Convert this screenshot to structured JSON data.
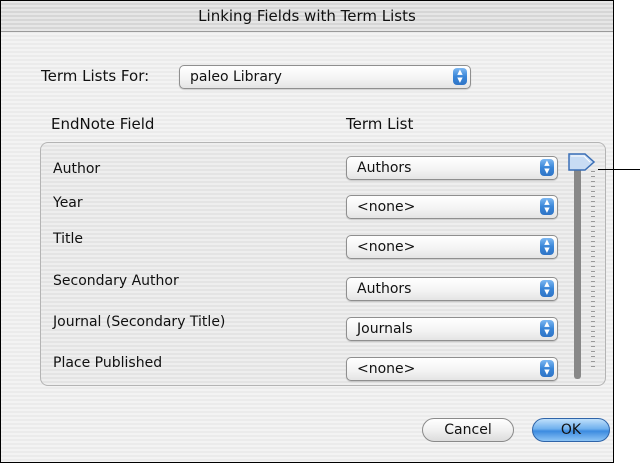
{
  "dialog": {
    "title": "Linking Fields with Term Lists"
  },
  "term_lists_for": {
    "label": "Term Lists For:",
    "selected": "paleo Library"
  },
  "columns": {
    "field_header": "EndNote Field",
    "list_header": "Term List"
  },
  "rows": [
    {
      "field": "Author",
      "term_list": "Authors"
    },
    {
      "field": "Year",
      "term_list": "<none>"
    },
    {
      "field": "Title",
      "term_list": "<none>"
    },
    {
      "field": "Secondary Author",
      "term_list": "Authors"
    },
    {
      "field": "Journal (Secondary Title)",
      "term_list": "Journals"
    },
    {
      "field": "Place Published",
      "term_list": "<none>"
    }
  ],
  "scroll_position": 0,
  "buttons": {
    "cancel": "Cancel",
    "ok": "OK"
  },
  "colors": {
    "accent": "#3c8be0",
    "default_button": "#6fb0ee"
  },
  "icons": {
    "popup_arrows": "up-down-arrows-icon",
    "scroll_thumb": "scroll-thumb-icon"
  }
}
